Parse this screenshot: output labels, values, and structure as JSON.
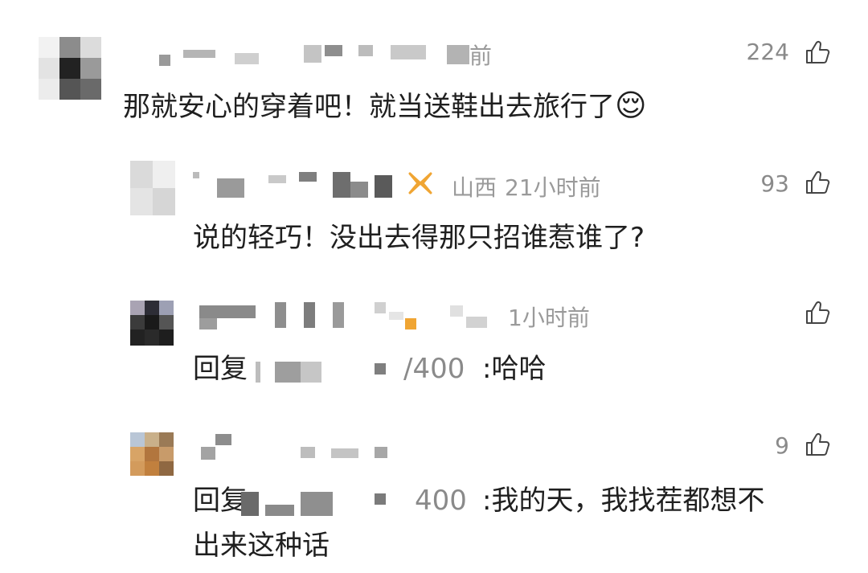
{
  "comments": [
    {
      "likes": "224",
      "text": "那就安心的穿着吧！就当送鞋出去旅行了",
      "emoji": "😌",
      "meta_suffix": "前"
    },
    {
      "likes": "93",
      "location": "山西",
      "time": "21小时前",
      "text": "说的轻巧！没出去得那只招谁惹谁了?"
    },
    {
      "likes": "",
      "time": "1小时前",
      "reply_prefix": "回复",
      "reply_target_tail": "/400",
      "text": ":哈哈"
    },
    {
      "likes": "9",
      "reply_prefix": "回复",
      "reply_target_tail": "400",
      "text_line1": ":我的天，我找茬都想不",
      "text_line2": "出来这种话"
    }
  ],
  "icons": {
    "like": "thumbs-up-icon",
    "badge": "gold-badge-icon"
  },
  "colors": {
    "text": "#1f1f1f",
    "meta": "#9a9a9a",
    "badge": "#f0a533"
  }
}
